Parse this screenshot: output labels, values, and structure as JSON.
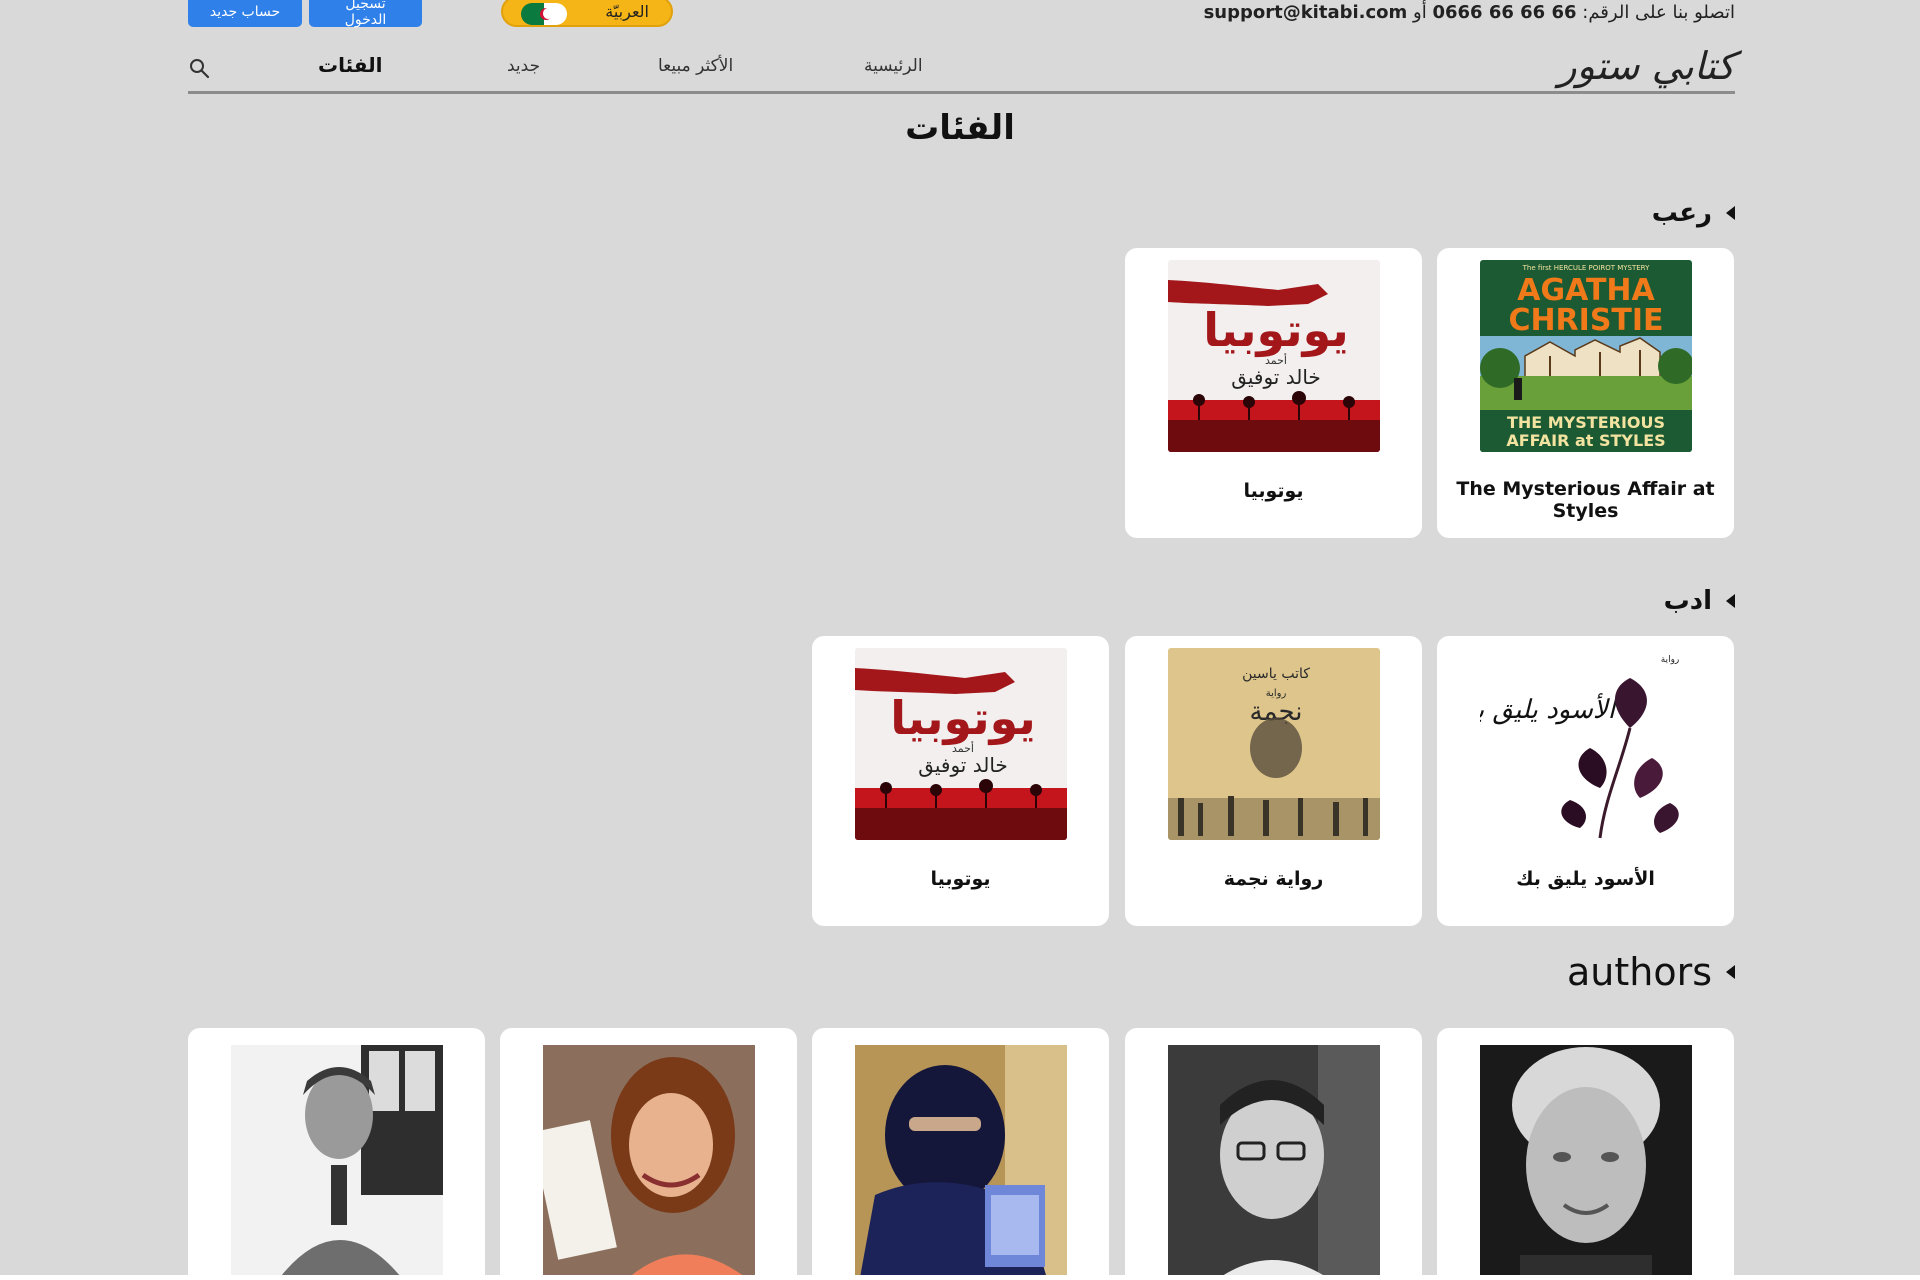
{
  "topbar": {
    "register_label": "حساب جديد",
    "login_label_line1": "تسجيل",
    "login_label_line2": "الدخول",
    "language_label": "العربيّة",
    "contact_prefix": "اتصلو بنا على الرقم:",
    "phone": "0666 66 66 66",
    "or_label": "أو",
    "email": "support@kitabi.com"
  },
  "nav": {
    "logo": "كتابي ستور",
    "items": [
      "الرئيسية",
      "الأكثر مبيعا",
      "جديد",
      "الفئات"
    ],
    "active": "الفئات"
  },
  "page_title": "الفئات",
  "sections": [
    {
      "title": "رعب",
      "books": [
        {
          "title": "The Mysterious Affair at Styles",
          "cover_top": "The first HERCULE POIROT MYSTERY",
          "cover_author": "AGATHA CHRISTIE",
          "cover_subtitle_1": "THE MYSTERIOUS",
          "cover_subtitle_2": "AFFAIR at STYLES"
        },
        {
          "title": "يوتوبيا",
          "cover_title": "يوتوبيا",
          "cover_author_small": "أحمد",
          "cover_author": "خالد توفيق"
        }
      ]
    },
    {
      "title": "ادب",
      "books": [
        {
          "title": "الأسود يليق بك",
          "cover_label": "رواية",
          "cover_title": "الأسود يليق بك"
        },
        {
          "title": "رواية نجمة",
          "cover_author": "كاتب ياسين",
          "cover_label": "رواية",
          "cover_title": "نجمة"
        },
        {
          "title": "يوتوبيا",
          "cover_title": "يوتوبيا",
          "cover_author_small": "أحمد",
          "cover_author": "خالد توفيق"
        }
      ]
    },
    {
      "title": "authors",
      "authors": [
        "agatha-christie",
        "ahmed-khaled-tawfik",
        "niqab-author",
        "ahlam-mosteghanemi",
        "kateb-yacine"
      ]
    }
  ],
  "colors": {
    "background": "#d9d9d9",
    "button_blue": "#2f80e8",
    "language_pill": "#f5b516",
    "card": "#ffffff"
  }
}
